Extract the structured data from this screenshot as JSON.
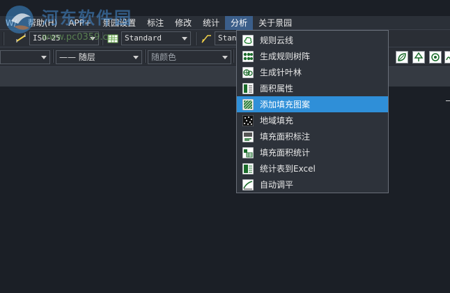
{
  "watermark": {
    "title": "河东软件园",
    "url": "www.pc0359.cn"
  },
  "menubar": {
    "items": [
      {
        "label": "W/"
      },
      {
        "label": "帮助(H)"
      },
      {
        "label": "APP+"
      },
      {
        "label": "景园设置"
      },
      {
        "label": "标注"
      },
      {
        "label": "修改"
      },
      {
        "label": "统计"
      },
      {
        "label": "分析"
      },
      {
        "label": "关于景园"
      }
    ],
    "active_index": 7
  },
  "toolbar1": {
    "dimstyle_value": "ISO-25",
    "tablestyle_value": "Standard",
    "mleaderstyle_value": "Stand"
  },
  "toolbar2": {
    "linetype_value": "—— 随层",
    "color_value": "随颜色"
  },
  "dropdown": {
    "items": [
      {
        "label": "规则云线",
        "icon": "cloud-icon"
      },
      {
        "label": "生成规则树阵",
        "icon": "tree-array-icon"
      },
      {
        "label": "生成针叶林",
        "icon": "conifer-icon"
      },
      {
        "label": "面积属性",
        "icon": "area-property-icon"
      },
      {
        "label": "添加填充图案",
        "icon": "add-hatch-icon"
      },
      {
        "label": "地域填充",
        "icon": "region-fill-icon"
      },
      {
        "label": "填充面积标注",
        "icon": "hatch-area-label-icon"
      },
      {
        "label": "填充面积统计",
        "icon": "hatch-area-stats-icon"
      },
      {
        "label": "统计表到Excel",
        "icon": "excel-icon"
      },
      {
        "label": "自动调平",
        "icon": "auto-level-icon"
      }
    ],
    "highlighted_index": 4
  },
  "colors": {
    "accent": "#2f8fd8",
    "background": "#1b1f26",
    "menubar": "#2b3038"
  }
}
